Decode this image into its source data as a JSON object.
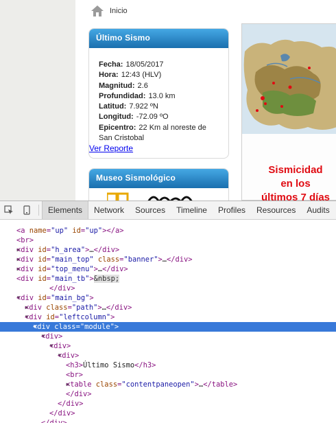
{
  "site": {
    "breadcrumb": {
      "home_label": "Inicio"
    },
    "quake_module": {
      "title": "Último Sismo",
      "rows": [
        {
          "label": "Fecha:",
          "value": "18/05/2017"
        },
        {
          "label": "Hora:",
          "value": "12:43 (HLV)"
        },
        {
          "label": "Magnitud:",
          "value": "2.6"
        },
        {
          "label": "Profundidad:",
          "value": "13.0 km"
        },
        {
          "label": "Latitud:",
          "value": "7.922 ºN"
        },
        {
          "label": "Longitud:",
          "value": "-72.09 ºO"
        },
        {
          "label": "Epicentro:",
          "value": "22 Km al noreste de"
        }
      ],
      "epicenter_cont": "San Cristobal",
      "report_link": "Ver Reporte"
    },
    "museum_module": {
      "title": "Museo Sismológico"
    },
    "map": {
      "caption_line1": "Sismicidad",
      "caption_line2": "en los",
      "caption_line3": "últimos 7 días"
    }
  },
  "devtools": {
    "tabs": [
      "Elements",
      "Network",
      "Sources",
      "Timeline",
      "Profiles",
      "Resources",
      "Audits"
    ],
    "active_tab": "Elements",
    "colors": {
      "tag": "#881280",
      "attr_name": "#994500",
      "attr_value": "#1a1aa6",
      "selection": "#3879d9"
    },
    "dom_lines": [
      {
        "indent": 0,
        "arrow": "",
        "parts": [
          [
            "tx",
            "  "
          ],
          [
            "tag",
            "<a "
          ],
          [
            "an",
            "name"
          ],
          [
            "tag",
            "="
          ],
          [
            "av",
            "\"up\""
          ],
          [
            "tag",
            " "
          ],
          [
            "an",
            "id"
          ],
          [
            "tag",
            "="
          ],
          [
            "av",
            "\"up\""
          ],
          [
            "tag",
            "></a>"
          ]
        ]
      },
      {
        "indent": 0,
        "arrow": "",
        "parts": [
          [
            "tx",
            "  "
          ],
          [
            "tag",
            "<br>"
          ]
        ]
      },
      {
        "indent": 0,
        "arrow": "▶",
        "parts": [
          [
            "tx",
            "  "
          ],
          [
            "tag",
            "<div "
          ],
          [
            "an",
            "id"
          ],
          [
            "tag",
            "="
          ],
          [
            "av",
            "\"h_area\""
          ],
          [
            "tag",
            ">"
          ],
          [
            "tx",
            "…"
          ],
          [
            "tag",
            "</div>"
          ]
        ]
      },
      {
        "indent": 0,
        "arrow": "▶",
        "parts": [
          [
            "tx",
            "  "
          ],
          [
            "tag",
            "<div "
          ],
          [
            "an",
            "id"
          ],
          [
            "tag",
            "="
          ],
          [
            "av",
            "\"main_top\""
          ],
          [
            "tag",
            " "
          ],
          [
            "an",
            "class"
          ],
          [
            "tag",
            "="
          ],
          [
            "av",
            "\"banner\""
          ],
          [
            "tag",
            ">"
          ],
          [
            "tx",
            "…"
          ],
          [
            "tag",
            "</div>"
          ]
        ]
      },
      {
        "indent": 0,
        "arrow": "▶",
        "parts": [
          [
            "tx",
            "  "
          ],
          [
            "tag",
            "<div "
          ],
          [
            "an",
            "id"
          ],
          [
            "tag",
            "="
          ],
          [
            "av",
            "\"top_menu\""
          ],
          [
            "tag",
            ">"
          ],
          [
            "tx",
            "…"
          ],
          [
            "tag",
            "</div>"
          ]
        ]
      },
      {
        "indent": 0,
        "arrow": "",
        "parts": [
          [
            "tx",
            "  "
          ],
          [
            "tag",
            "<div "
          ],
          [
            "an",
            "id"
          ],
          [
            "tag",
            "="
          ],
          [
            "av",
            "\"main_tb\""
          ],
          [
            "tag",
            ">"
          ],
          [
            "ent",
            "&nbsp;"
          ]
        ]
      },
      {
        "indent": 4,
        "arrow": "",
        "parts": [
          [
            "tag",
            "</div>"
          ]
        ]
      },
      {
        "indent": 0,
        "arrow": "▼",
        "parts": [
          [
            "tx",
            "  "
          ],
          [
            "tag",
            "<div "
          ],
          [
            "an",
            "id"
          ],
          [
            "tag",
            "="
          ],
          [
            "av",
            "\"main_bg\""
          ],
          [
            "tag",
            ">"
          ]
        ]
      },
      {
        "indent": 1,
        "arrow": "▶",
        "parts": [
          [
            "tx",
            "  "
          ],
          [
            "tag",
            "<div "
          ],
          [
            "an",
            "class"
          ],
          [
            "tag",
            "="
          ],
          [
            "av",
            "\"path\""
          ],
          [
            "tag",
            ">"
          ],
          [
            "tx",
            "…"
          ],
          [
            "tag",
            "</div>"
          ]
        ]
      },
      {
        "indent": 1,
        "arrow": "▼",
        "parts": [
          [
            "tx",
            "  "
          ],
          [
            "tag",
            "<div "
          ],
          [
            "an",
            "id"
          ],
          [
            "tag",
            "="
          ],
          [
            "av",
            "\"leftcolumn\""
          ],
          [
            "tag",
            ">"
          ]
        ]
      },
      {
        "indent": 2,
        "arrow": "▼",
        "selected": true,
        "parts": [
          [
            "tx",
            "  "
          ],
          [
            "tag",
            "<div "
          ],
          [
            "an",
            "class"
          ],
          [
            "tag",
            "="
          ],
          [
            "av",
            "\"module\""
          ],
          [
            "tag",
            ">"
          ]
        ]
      },
      {
        "indent": 3,
        "arrow": "▼",
        "parts": [
          [
            "tx",
            "  "
          ],
          [
            "tag",
            "<div>"
          ]
        ]
      },
      {
        "indent": 4,
        "arrow": "▼",
        "parts": [
          [
            "tx",
            "  "
          ],
          [
            "tag",
            "<div>"
          ]
        ]
      },
      {
        "indent": 5,
        "arrow": "▼",
        "parts": [
          [
            "tx",
            "  "
          ],
          [
            "tag",
            "<div>"
          ]
        ]
      },
      {
        "indent": 6,
        "arrow": "",
        "parts": [
          [
            "tx",
            "  "
          ],
          [
            "tag",
            "<h3>"
          ],
          [
            "tx",
            "Último Sismo"
          ],
          [
            "tag",
            "</h3>"
          ]
        ]
      },
      {
        "indent": 6,
        "arrow": "",
        "parts": [
          [
            "tx",
            "  "
          ],
          [
            "tag",
            "<br>"
          ]
        ]
      },
      {
        "indent": 6,
        "arrow": "▶",
        "parts": [
          [
            "tx",
            "  "
          ],
          [
            "tag",
            "<table "
          ],
          [
            "an",
            "class"
          ],
          [
            "tag",
            "="
          ],
          [
            "av",
            "\"contentpaneopen\""
          ],
          [
            "tag",
            ">"
          ],
          [
            "tx",
            "…"
          ],
          [
            "tag",
            "</table>"
          ]
        ]
      },
      {
        "indent": 6,
        "arrow": "",
        "parts": [
          [
            "tag",
            "</div>"
          ]
        ]
      },
      {
        "indent": 5,
        "arrow": "",
        "parts": [
          [
            "tag",
            "</div>"
          ]
        ]
      },
      {
        "indent": 4,
        "arrow": "",
        "parts": [
          [
            "tag",
            "</div>"
          ]
        ]
      },
      {
        "indent": 3,
        "arrow": "",
        "parts": [
          [
            "tag",
            "</div>"
          ]
        ]
      }
    ]
  }
}
